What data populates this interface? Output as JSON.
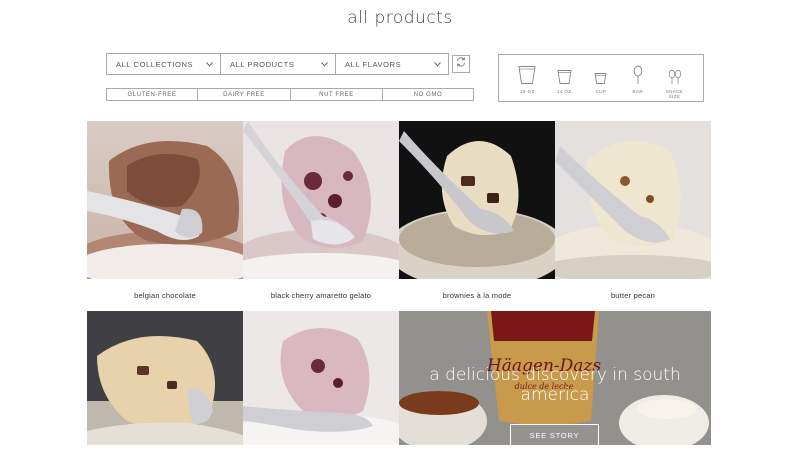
{
  "page": {
    "title": "all products"
  },
  "filters": {
    "collections": "ALL COLLECTIONS",
    "products": "ALL PRODUCTS",
    "flavors": "ALL FLAVORS",
    "checkboxes": [
      "GLUTEN-FREE",
      "DAIRY FREE",
      "NUT FREE",
      "NO GMO"
    ]
  },
  "sizes": [
    {
      "label": "28 OZ",
      "icon": "pint-large-icon"
    },
    {
      "label": "14 OZ",
      "icon": "pint-small-icon"
    },
    {
      "label": "CUP",
      "icon": "cup-icon"
    },
    {
      "label": "BAR",
      "icon": "bar-icon"
    },
    {
      "label": "SNACK SIZE",
      "icon": "snack-size-icon"
    }
  ],
  "products": [
    {
      "name": "belgian chocolate"
    },
    {
      "name": "black cherry amaretto gelato"
    },
    {
      "name": "brownies à la mode"
    },
    {
      "name": "butter pecan"
    },
    {
      "name": ""
    },
    {
      "name": ""
    }
  ],
  "promo": {
    "headline": "a delicious discovery in south america",
    "button": "SEE STORY",
    "brand": "Häagen-Dazs",
    "flavor": "dulce de leche"
  },
  "colors": {
    "border": "#aaaaaa",
    "text": "#333333",
    "brand_red": "#8b1a1a"
  }
}
